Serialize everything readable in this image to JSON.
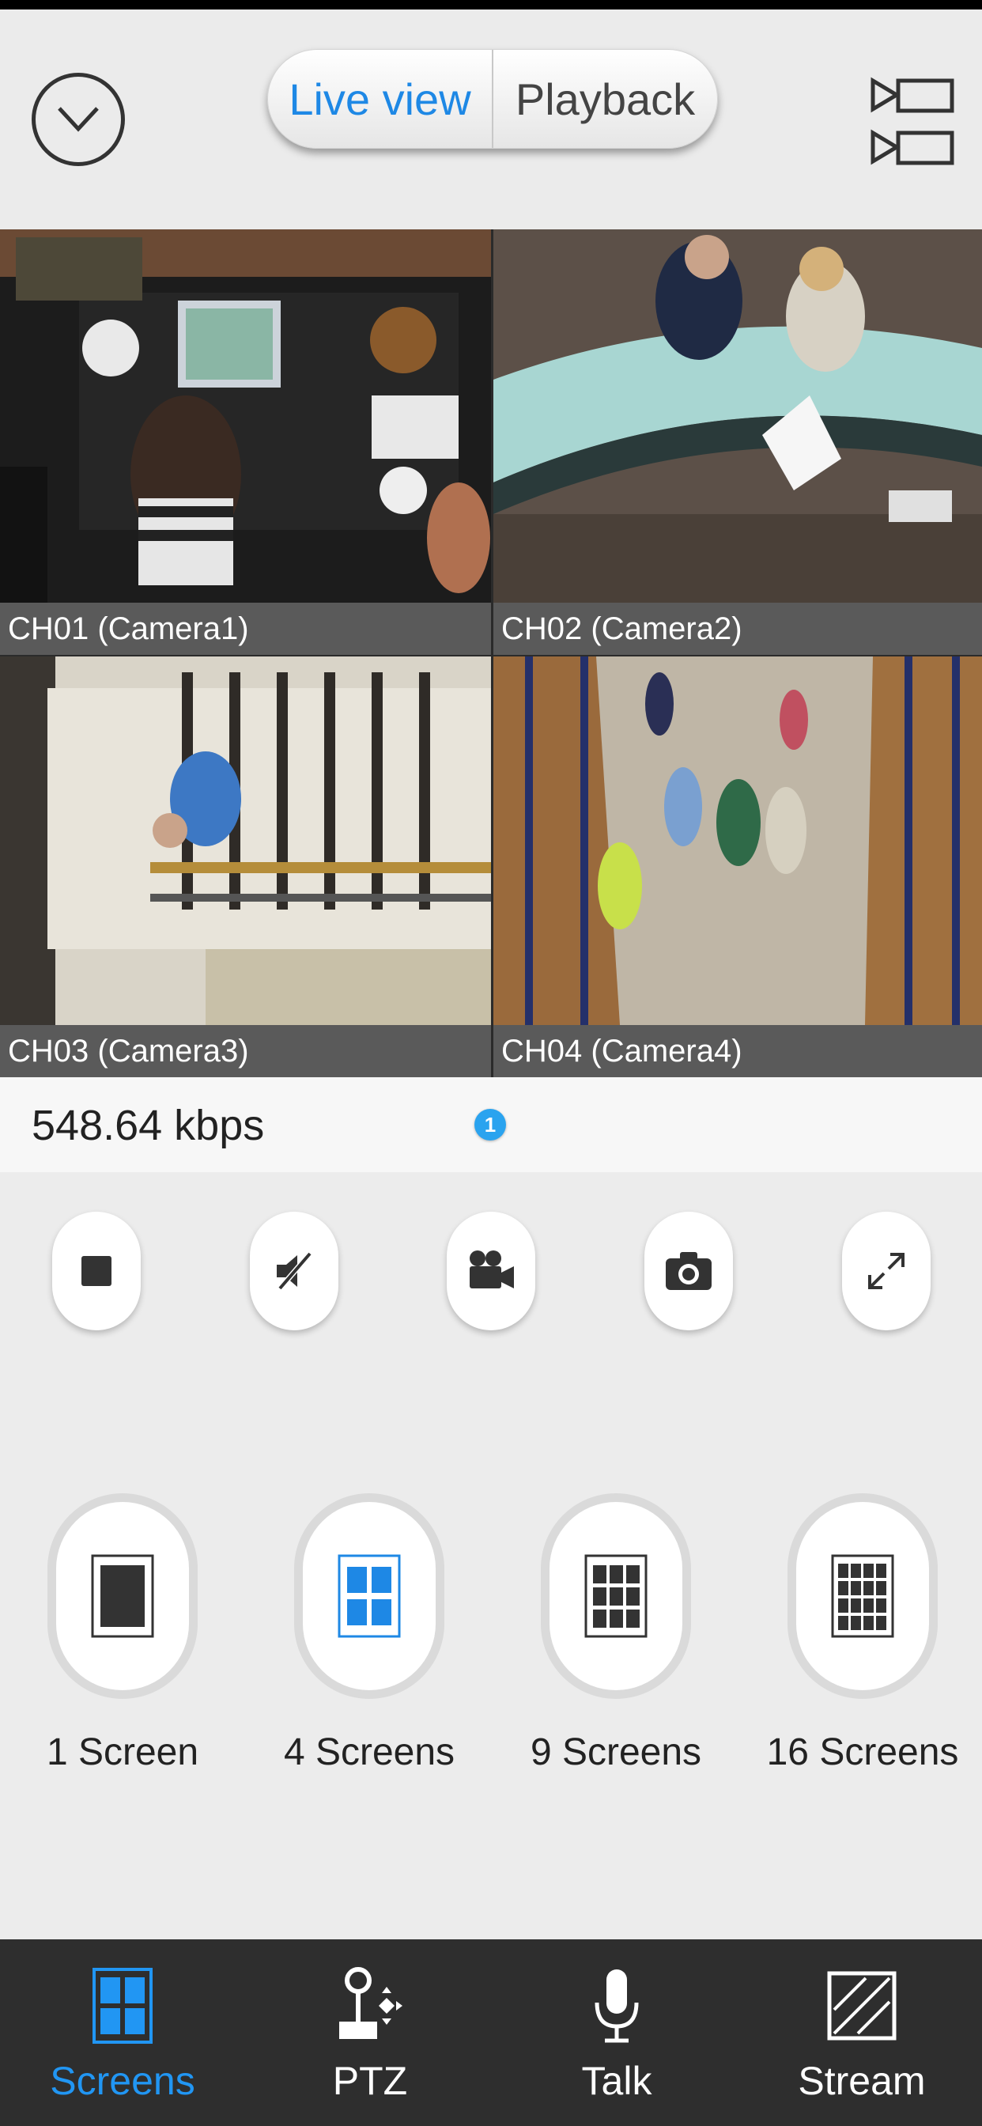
{
  "header": {
    "live_view_label": "Live view",
    "playback_label": "Playback"
  },
  "cameras": [
    {
      "caption": "CH01 (Camera1)"
    },
    {
      "caption": "CH02 (Camera2)"
    },
    {
      "caption": "CH03 (Camera3)"
    },
    {
      "caption": "CH04 (Camera4)"
    }
  ],
  "bitrate": "548.64 kbps",
  "page_indicator": "1",
  "layouts": [
    {
      "label": "1 Screen"
    },
    {
      "label": "4 Screens"
    },
    {
      "label": "9 Screens"
    },
    {
      "label": "16 Screens"
    }
  ],
  "tabs": [
    {
      "label": "Screens"
    },
    {
      "label": "PTZ"
    },
    {
      "label": "Talk"
    },
    {
      "label": "Stream"
    }
  ],
  "colors": {
    "accent": "#1e88e5",
    "tabbar": "#2e2e2e",
    "caption_bg": "#5a5a5a"
  }
}
